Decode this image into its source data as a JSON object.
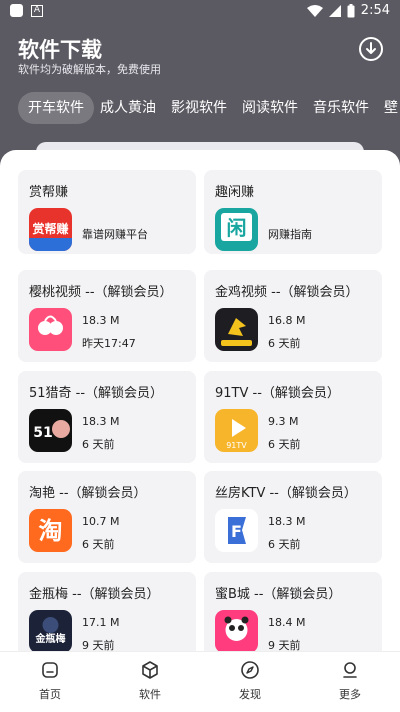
{
  "status": {
    "time": "2:54"
  },
  "header": {
    "title": "软件下载",
    "subtitle": "软件均为破解版本，免费使用"
  },
  "tabs": [
    {
      "label": "开车软件"
    },
    {
      "label": "成人黄油"
    },
    {
      "label": "影视软件"
    },
    {
      "label": "阅读软件"
    },
    {
      "label": "音乐软件"
    },
    {
      "label": "壁纸"
    }
  ],
  "cards": [
    {
      "name": "赏帮赚",
      "desc": "靠谱网赚平台",
      "icon_text": "赏帮赚"
    },
    {
      "name": "趣闲赚",
      "desc": "网赚指南",
      "icon_text": "闲"
    },
    {
      "name": "樱桃视频 --（解锁会员）",
      "size": "18.3 M",
      "date": "昨天17:47",
      "icon_text": "樱桃视频"
    },
    {
      "name": "金鸡视频 --（解锁会员）",
      "size": "16.8 M",
      "date": "6 天前",
      "icon_text": "金鸡视频"
    },
    {
      "name": "51猎奇 --（解锁会员）",
      "size": "18.3 M",
      "date": "6 天前",
      "icon_text": "猎奇"
    },
    {
      "name": "91TV --（解锁会员）",
      "size": "9.3 M",
      "date": "6 天前",
      "icon_text": "91TV"
    },
    {
      "name": "淘艳 --（解锁会员）",
      "size": "10.7 M",
      "date": "6 天前",
      "icon_text": "淘"
    },
    {
      "name": "丝房KTV --（解锁会员）",
      "size": "18.3 M",
      "date": "6 天前",
      "icon_text": "F"
    },
    {
      "name": "金瓶梅 --（解锁会员）",
      "size": "17.1 M",
      "date": "9 天前",
      "icon_text": "金瓶梅"
    },
    {
      "name": "蜜B城 --（解锁会员）",
      "size": "18.4 M",
      "date": "9 天前",
      "icon_text": "蜜B城"
    }
  ],
  "nav": [
    {
      "label": "首页"
    },
    {
      "label": "软件"
    },
    {
      "label": "发现"
    },
    {
      "label": "更多"
    }
  ],
  "colors": {
    "header_bg": "#5b5a62",
    "card_bg": "#f3f3f5",
    "tab_active_bg": "#7a7980"
  }
}
